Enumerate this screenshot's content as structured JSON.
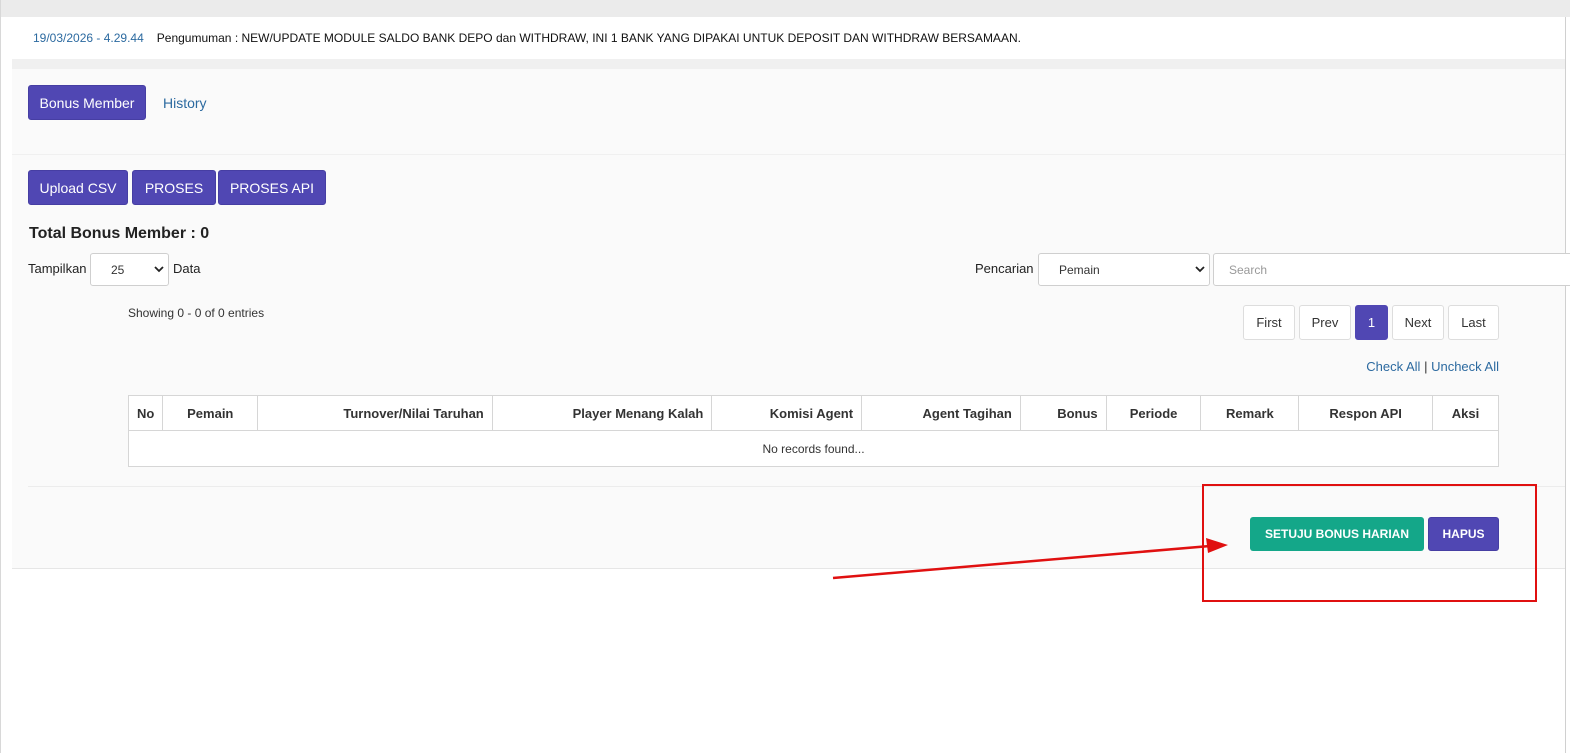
{
  "announcement": {
    "timestamp": "19/03/2026 - 4.29.44",
    "message": "Pengumuman : NEW/UPDATE MODULE SALDO BANK DEPO dan WITHDRAW, INI 1 BANK YANG DIPAKAI UNTUK DEPOSIT DAN WITHDRAW BERSAMAAN."
  },
  "tabs": {
    "bonus_member": "Bonus Member",
    "history": "History"
  },
  "toolbar": {
    "upload_csv": "Upload CSV",
    "proses": "PROSES",
    "proses_api": "PROSES API"
  },
  "summary": {
    "title": "Total Bonus Member : 0"
  },
  "length_control": {
    "prefix": "Tampilkan",
    "selected": "25",
    "suffix": "Data"
  },
  "search": {
    "label": "Pencarian",
    "field_selected": "Pemain",
    "placeholder": "Search"
  },
  "info": {
    "showing": "Showing 0 - 0 of 0 entries"
  },
  "pagination": {
    "first": "First",
    "prev": "Prev",
    "current": "1",
    "next": "Next",
    "last": "Last"
  },
  "check_links": {
    "check_all": "Check All",
    "separator": "|",
    "uncheck_all": "Uncheck All"
  },
  "table": {
    "columns": [
      "No",
      "Pemain",
      "Turnover/Nilai Taruhan",
      "Player Menang Kalah",
      "Komisi Agent",
      "Agent Tagihan",
      "Bonus",
      "Periode",
      "Remark",
      "Respon API",
      "Aksi"
    ],
    "empty_message": "No records found..."
  },
  "actions": {
    "approve_daily_bonus": "SETUJU BONUS HARIAN",
    "delete": "HAPUS"
  },
  "colors": {
    "primary": "#5047b3",
    "success": "#14a789",
    "link": "#2c6aa0",
    "annotation": "#e01010"
  }
}
